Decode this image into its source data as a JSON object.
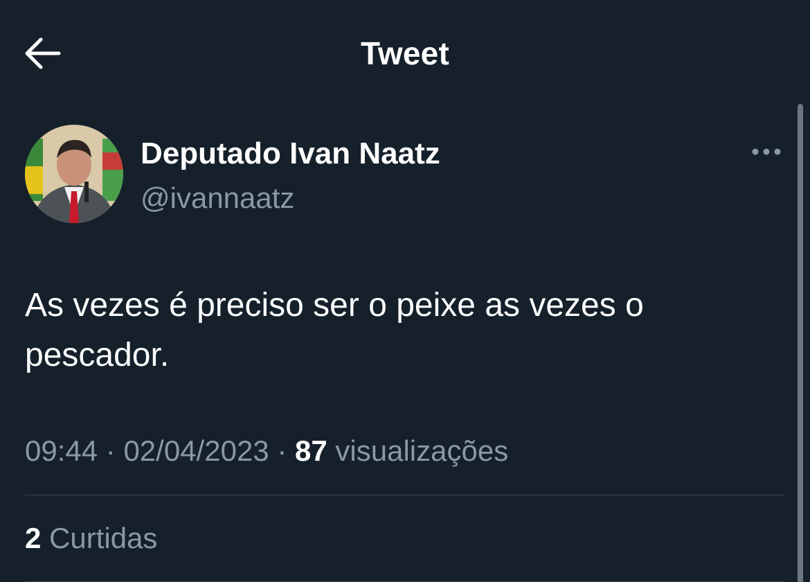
{
  "header": {
    "title": "Tweet",
    "back_icon": "arrow-left-icon"
  },
  "tweet": {
    "author": {
      "name": "Deputado Ivan Naatz",
      "handle": "@ivannaatz",
      "avatar_icon": "avatar-photo"
    },
    "more_icon": "more-horizontal-icon",
    "text": "As vezes é preciso ser o peixe as vezes o pescador.",
    "time": "09:44",
    "separator": "·",
    "date": "02/04/2023",
    "views_count": "87",
    "views_label": "visualizações",
    "likes_count": "2",
    "likes_label": "Curtidas"
  },
  "colors": {
    "background": "#15202b",
    "text_primary": "#ffffff",
    "text_secondary": "#8b98a5",
    "divider": "#38444d"
  }
}
